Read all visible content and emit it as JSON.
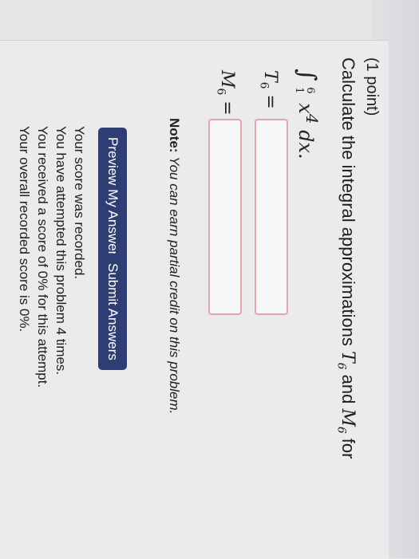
{
  "problem": {
    "points": "(1 point)",
    "prompt_text": "Calculate the integral approximations",
    "T_label": "T",
    "sub": "6",
    "and": "and",
    "M_label": "M",
    "for": "for",
    "integral": {
      "upper": "6",
      "lower": "1",
      "integrand": "x",
      "power": "4",
      "dx": "dx."
    },
    "fields": [
      {
        "label": "T",
        "sub": "6",
        "eq": "=",
        "value": ""
      },
      {
        "label": "M",
        "sub": "6",
        "eq": "=",
        "value": ""
      }
    ]
  },
  "note": {
    "bold": "Note:",
    "text": "You can earn partial credit on this problem."
  },
  "buttons": {
    "preview": "Preview My Answers",
    "submit": "Submit Answers"
  },
  "status_lines": [
    "Your score was recorded.",
    "You have attempted this problem 4 times.",
    "You received a score of 0% for this attempt.",
    "Your overall recorded score is 0%."
  ],
  "colors": {
    "button_bg": "#2e3d73",
    "field_border": "#e1a7aa"
  }
}
